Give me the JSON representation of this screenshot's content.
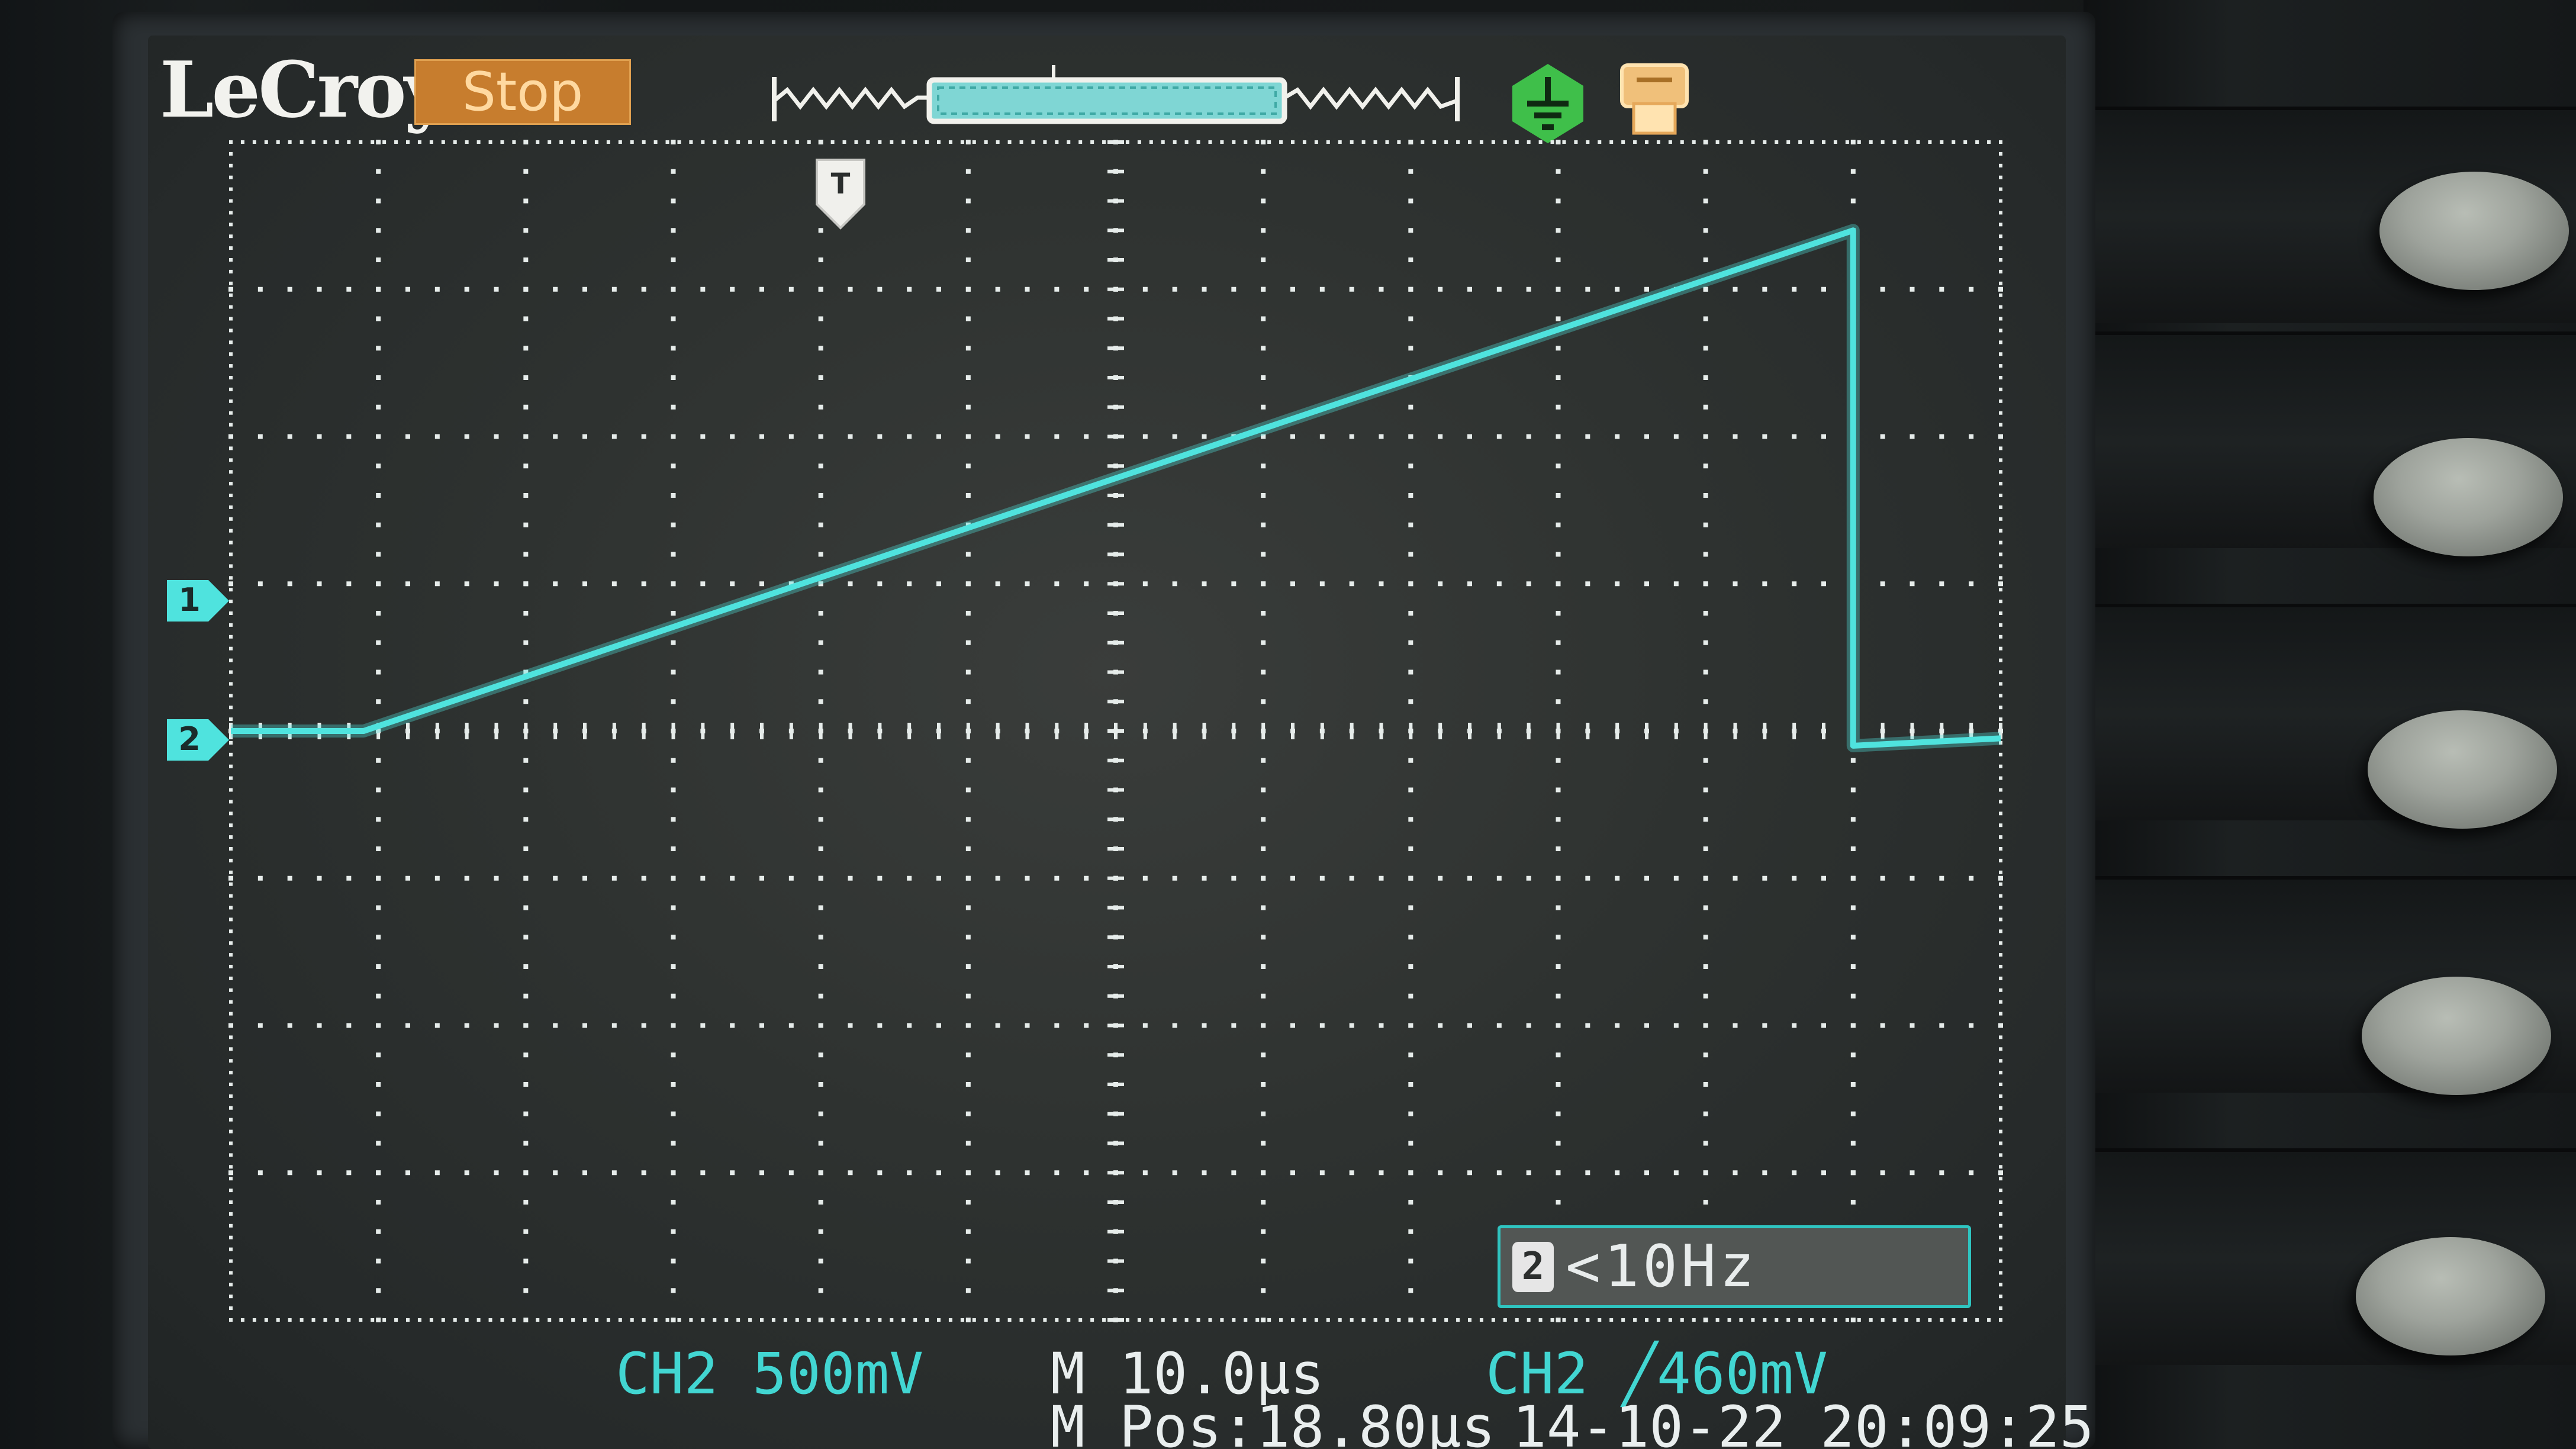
{
  "header": {
    "brand": "LeCroy",
    "run_state": "Stop"
  },
  "channels": [
    {
      "label": "1",
      "color": "#2fc4c0"
    },
    {
      "label": "2",
      "color": "#2fc4c0"
    }
  ],
  "trigger_marker_label": "T",
  "freq_readout": {
    "channel_icon": "2",
    "value": "<10Hz"
  },
  "status": {
    "ch2_scale": "CH2 500mV",
    "timebase": "M 10.0µs",
    "h_position": "M Pos:18.80µs",
    "trigger": "CH2 ╱460mV",
    "datetime": "14-10-22 20:09:25"
  },
  "colors": {
    "trace": "#4fe3de",
    "grid": "#e6ecea",
    "run_state_bg": "#c77d2e"
  },
  "icons": {
    "memory": "acquisition-memory-bar-icon",
    "ground": "ground-icon",
    "print": "print-icon"
  },
  "chart_data": {
    "type": "line",
    "title": "",
    "xlabel": "",
    "ylabel": "",
    "x_divisions": 12,
    "y_divisions": 8,
    "x_unit": "µs/div",
    "y_unit": "mV/div",
    "xlim": [
      0,
      12
    ],
    "ylim": [
      -4,
      4
    ],
    "grid": true,
    "series": [
      {
        "x": [
          0,
          0.9,
          11.0,
          11.0,
          12.0
        ],
        "y": [
          0.0,
          0.0,
          3.4,
          -0.1,
          -0.05
        ]
      }
    ]
  }
}
